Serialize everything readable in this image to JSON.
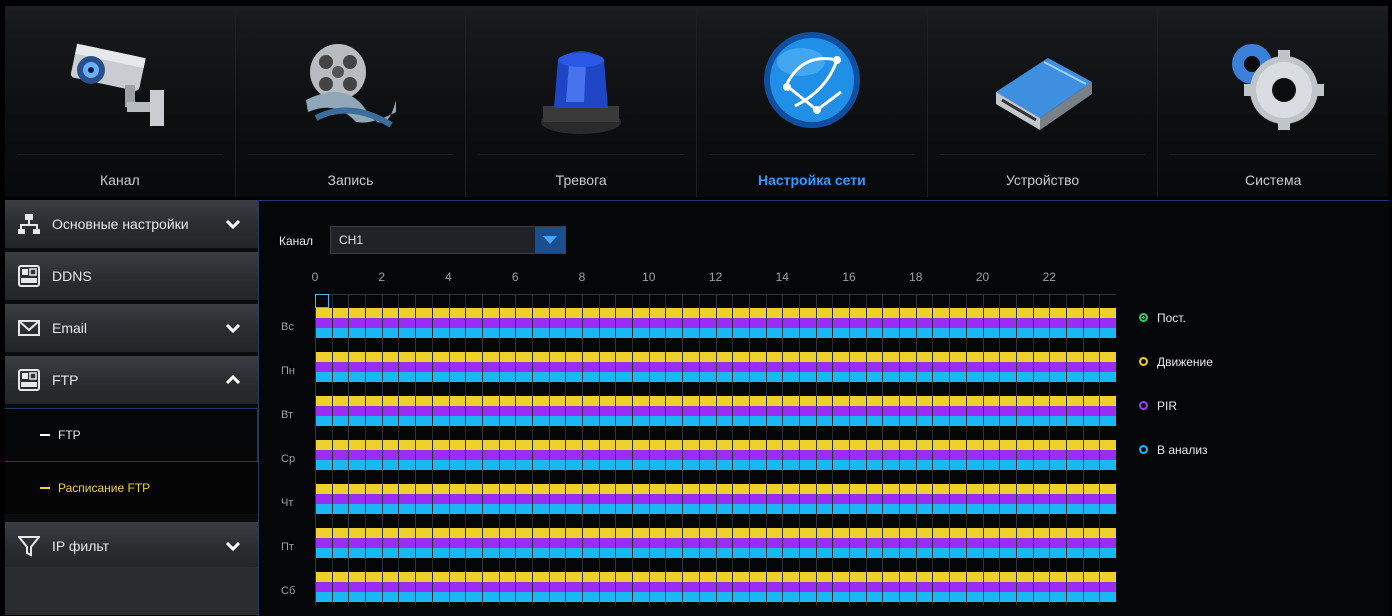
{
  "top_tabs": [
    {
      "label": "Канал",
      "icon": "camera-icon"
    },
    {
      "label": "Запись",
      "icon": "film-reel-icon"
    },
    {
      "label": "Тревога",
      "icon": "alarm-light-icon"
    },
    {
      "label": "Настройка сети",
      "icon": "globe-network-icon"
    },
    {
      "label": "Устройство",
      "icon": "hard-drive-icon"
    },
    {
      "label": "Система",
      "icon": "gears-icon"
    }
  ],
  "active_tab": "Настройка сети",
  "sidebar": {
    "items": [
      {
        "label": "Основные настройки",
        "icon": "network-icon",
        "chevron": "down"
      },
      {
        "label": "DDNS",
        "icon": "ddns-icon"
      },
      {
        "label": "Email",
        "icon": "envelope-icon",
        "chevron": "down"
      },
      {
        "label": "FTP",
        "icon": "ftp-icon",
        "chevron": "up"
      }
    ],
    "ftp_sub": [
      {
        "label": "FTP",
        "selected": false
      },
      {
        "label": "Расписание FTP",
        "selected": true
      }
    ],
    "ip_filter": {
      "label": "IP фильт",
      "icon": "funnel-icon",
      "chevron": "down"
    }
  },
  "schedule": {
    "channel_label": "Канал",
    "channel_value": "CH1",
    "hour_labels": [
      "0",
      "2",
      "4",
      "6",
      "8",
      "10",
      "12",
      "14",
      "16",
      "18",
      "20",
      "22"
    ],
    "days": [
      "Вс",
      "Пн",
      "Вт",
      "Ср",
      "Чт",
      "Пт",
      "Сб"
    ],
    "legend": [
      {
        "label": "Пост.",
        "color": "#2ecc71"
      },
      {
        "label": "Движение",
        "color": "#eed02c"
      },
      {
        "label": "PIR",
        "color": "#a23cf5"
      },
      {
        "label": "В анализ",
        "color": "#19b8f5"
      }
    ],
    "colors": {
      "motion": "#eed02c",
      "pir": "#9b2cf5",
      "analysis": "#19b8f5"
    }
  }
}
